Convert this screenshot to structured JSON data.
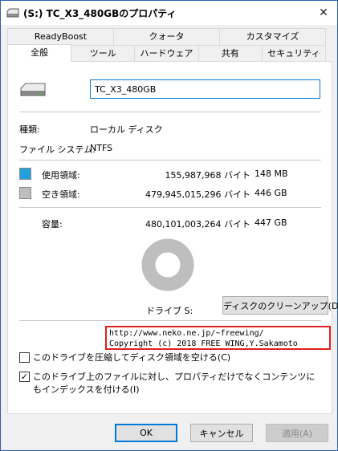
{
  "window": {
    "title": "(S:) TC_X3_480GBのプロパティ",
    "close_glyph": "✕"
  },
  "tabs": {
    "row1": [
      "ReadyBoost",
      "クォータ",
      "カスタマイズ"
    ],
    "row2": [
      "全般",
      "ツール",
      "ハードウェア",
      "共有",
      "セキュリティ"
    ],
    "active": "全般"
  },
  "general": {
    "drive_name": "TC_X3_480GB",
    "type_label": "種類:",
    "type_value": "ローカル ディスク",
    "fs_label": "ファイル システム:",
    "fs_value": "NTFS",
    "used": {
      "label": "使用領域:",
      "bytes": "155,987,968 バイト",
      "size": "148 MB",
      "color": "#26a0da"
    },
    "free": {
      "label": "空き領域:",
      "bytes": "479,945,015,296 バイト",
      "size": "446 GB",
      "color": "#bebebe"
    },
    "capacity": {
      "label": "容量:",
      "bytes": "480,101,003,264 バイト",
      "size": "447 GB"
    },
    "usage_fraction": 0.000325,
    "drive_label": "ドライブ S:",
    "cleanup_button": "ディスクのクリーンアップ(D)",
    "watermark_line1": "http://www.neko.ne.jp/~freewing/",
    "watermark_line2": "Copyright (c) 2018 FREE WING,Y.Sakamoto",
    "compress_label": "このドライブを圧縮してディスク領域を空ける(C)",
    "compress_checked": false,
    "index_label": "このドライブ上のファイルに対し、プロパティだけでなくコンテンツにもインデックスを付ける(I)",
    "index_checked": true,
    "check_glyph": "✓"
  },
  "buttons": {
    "ok": "OK",
    "cancel": "キャンセル",
    "apply": "適用(A)"
  },
  "icons": {
    "title": "drive-icon",
    "drive": "hard-drive-icon",
    "close": "close-icon"
  }
}
